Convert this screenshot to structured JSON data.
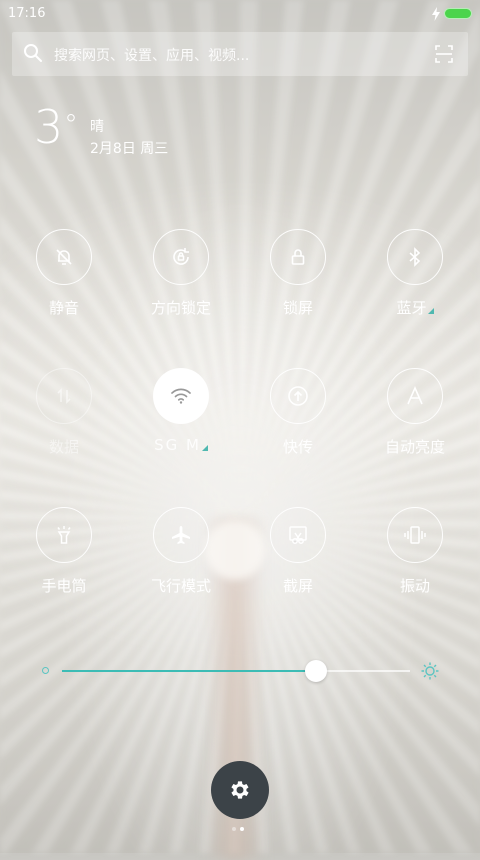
{
  "status_bar": {
    "time": "17:16",
    "battery_color": "#4cd44c"
  },
  "search": {
    "placeholder": "搜索网页、设置、应用、视频..."
  },
  "weather": {
    "temp": "3",
    "degree": "°",
    "condition": "晴",
    "date": "2月8日 周三"
  },
  "tiles": [
    {
      "label": "静音",
      "icon": "bell-off-icon",
      "state": "off"
    },
    {
      "label": "方向锁定",
      "icon": "rotation-lock-icon",
      "state": "off"
    },
    {
      "label": "锁屏",
      "icon": "lock-icon",
      "state": "off"
    },
    {
      "label": "蓝牙",
      "icon": "bluetooth-icon",
      "state": "off"
    },
    {
      "label": "数据",
      "icon": "data-arrows-icon",
      "state": "disabled"
    },
    {
      "label": "SG M",
      "icon": "wifi-icon",
      "state": "active"
    },
    {
      "label": "快传",
      "icon": "transfer-icon",
      "state": "off"
    },
    {
      "label": "自动亮度",
      "icon": "auto-brightness-icon",
      "state": "off"
    },
    {
      "label": "手电筒",
      "icon": "flashlight-icon",
      "state": "off"
    },
    {
      "label": "飞行模式",
      "icon": "airplane-icon",
      "state": "off"
    },
    {
      "label": "截屏",
      "icon": "screenshot-icon",
      "state": "off"
    },
    {
      "label": "振动",
      "icon": "vibrate-icon",
      "state": "off"
    }
  ],
  "brightness": {
    "level": 0.73,
    "accent": "#3cbcb5"
  },
  "settings_button": {
    "icon": "gear-icon",
    "background": "#3c4348"
  },
  "pager": {
    "pages": 2,
    "current": 2
  }
}
